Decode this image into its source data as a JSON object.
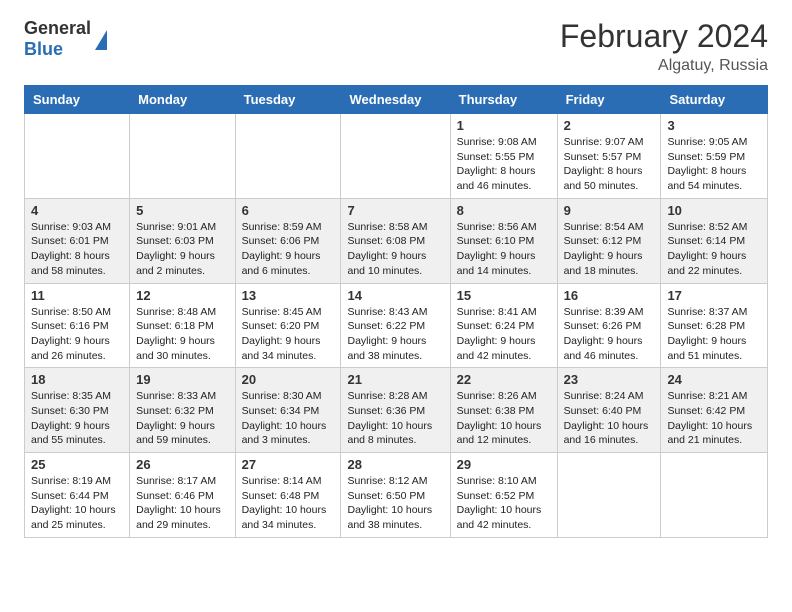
{
  "header": {
    "logo": {
      "general": "General",
      "blue": "Blue"
    },
    "title": "February 2024",
    "location": "Algatuy, Russia"
  },
  "days_of_week": [
    "Sunday",
    "Monday",
    "Tuesday",
    "Wednesday",
    "Thursday",
    "Friday",
    "Saturday"
  ],
  "weeks": [
    [
      {
        "day": "",
        "info": ""
      },
      {
        "day": "",
        "info": ""
      },
      {
        "day": "",
        "info": ""
      },
      {
        "day": "",
        "info": ""
      },
      {
        "day": "1",
        "info": "Sunrise: 9:08 AM\nSunset: 5:55 PM\nDaylight: 8 hours and 46 minutes."
      },
      {
        "day": "2",
        "info": "Sunrise: 9:07 AM\nSunset: 5:57 PM\nDaylight: 8 hours and 50 minutes."
      },
      {
        "day": "3",
        "info": "Sunrise: 9:05 AM\nSunset: 5:59 PM\nDaylight: 8 hours and 54 minutes."
      }
    ],
    [
      {
        "day": "4",
        "info": "Sunrise: 9:03 AM\nSunset: 6:01 PM\nDaylight: 8 hours and 58 minutes."
      },
      {
        "day": "5",
        "info": "Sunrise: 9:01 AM\nSunset: 6:03 PM\nDaylight: 9 hours and 2 minutes."
      },
      {
        "day": "6",
        "info": "Sunrise: 8:59 AM\nSunset: 6:06 PM\nDaylight: 9 hours and 6 minutes."
      },
      {
        "day": "7",
        "info": "Sunrise: 8:58 AM\nSunset: 6:08 PM\nDaylight: 9 hours and 10 minutes."
      },
      {
        "day": "8",
        "info": "Sunrise: 8:56 AM\nSunset: 6:10 PM\nDaylight: 9 hours and 14 minutes."
      },
      {
        "day": "9",
        "info": "Sunrise: 8:54 AM\nSunset: 6:12 PM\nDaylight: 9 hours and 18 minutes."
      },
      {
        "day": "10",
        "info": "Sunrise: 8:52 AM\nSunset: 6:14 PM\nDaylight: 9 hours and 22 minutes."
      }
    ],
    [
      {
        "day": "11",
        "info": "Sunrise: 8:50 AM\nSunset: 6:16 PM\nDaylight: 9 hours and 26 minutes."
      },
      {
        "day": "12",
        "info": "Sunrise: 8:48 AM\nSunset: 6:18 PM\nDaylight: 9 hours and 30 minutes."
      },
      {
        "day": "13",
        "info": "Sunrise: 8:45 AM\nSunset: 6:20 PM\nDaylight: 9 hours and 34 minutes."
      },
      {
        "day": "14",
        "info": "Sunrise: 8:43 AM\nSunset: 6:22 PM\nDaylight: 9 hours and 38 minutes."
      },
      {
        "day": "15",
        "info": "Sunrise: 8:41 AM\nSunset: 6:24 PM\nDaylight: 9 hours and 42 minutes."
      },
      {
        "day": "16",
        "info": "Sunrise: 8:39 AM\nSunset: 6:26 PM\nDaylight: 9 hours and 46 minutes."
      },
      {
        "day": "17",
        "info": "Sunrise: 8:37 AM\nSunset: 6:28 PM\nDaylight: 9 hours and 51 minutes."
      }
    ],
    [
      {
        "day": "18",
        "info": "Sunrise: 8:35 AM\nSunset: 6:30 PM\nDaylight: 9 hours and 55 minutes."
      },
      {
        "day": "19",
        "info": "Sunrise: 8:33 AM\nSunset: 6:32 PM\nDaylight: 9 hours and 59 minutes."
      },
      {
        "day": "20",
        "info": "Sunrise: 8:30 AM\nSunset: 6:34 PM\nDaylight: 10 hours and 3 minutes."
      },
      {
        "day": "21",
        "info": "Sunrise: 8:28 AM\nSunset: 6:36 PM\nDaylight: 10 hours and 8 minutes."
      },
      {
        "day": "22",
        "info": "Sunrise: 8:26 AM\nSunset: 6:38 PM\nDaylight: 10 hours and 12 minutes."
      },
      {
        "day": "23",
        "info": "Sunrise: 8:24 AM\nSunset: 6:40 PM\nDaylight: 10 hours and 16 minutes."
      },
      {
        "day": "24",
        "info": "Sunrise: 8:21 AM\nSunset: 6:42 PM\nDaylight: 10 hours and 21 minutes."
      }
    ],
    [
      {
        "day": "25",
        "info": "Sunrise: 8:19 AM\nSunset: 6:44 PM\nDaylight: 10 hours and 25 minutes."
      },
      {
        "day": "26",
        "info": "Sunrise: 8:17 AM\nSunset: 6:46 PM\nDaylight: 10 hours and 29 minutes."
      },
      {
        "day": "27",
        "info": "Sunrise: 8:14 AM\nSunset: 6:48 PM\nDaylight: 10 hours and 34 minutes."
      },
      {
        "day": "28",
        "info": "Sunrise: 8:12 AM\nSunset: 6:50 PM\nDaylight: 10 hours and 38 minutes."
      },
      {
        "day": "29",
        "info": "Sunrise: 8:10 AM\nSunset: 6:52 PM\nDaylight: 10 hours and 42 minutes."
      },
      {
        "day": "",
        "info": ""
      },
      {
        "day": "",
        "info": ""
      }
    ]
  ]
}
